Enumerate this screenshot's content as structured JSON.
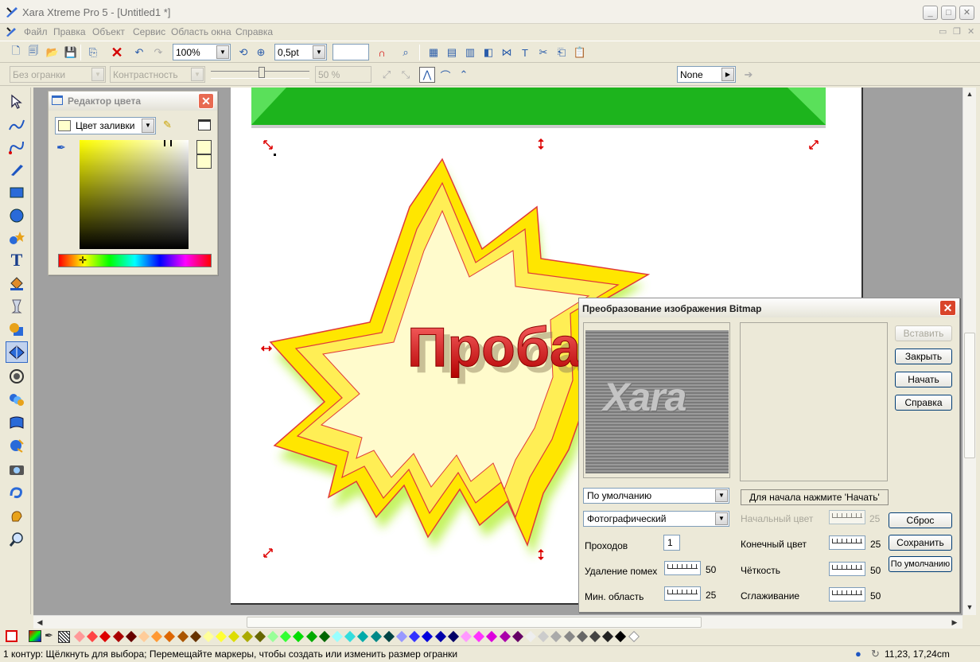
{
  "window": {
    "title": "Xara Xtreme Pro 5 - [Untitled1 *]"
  },
  "menu": [
    "Файл",
    "Правка",
    "Объект",
    "Сервис",
    "Область окна",
    "Справка"
  ],
  "toolbar": {
    "zoom": "100%",
    "line_width": "0,5pt"
  },
  "toolbar2": {
    "bevel_type": "Без огранки",
    "contrast": "Контрастность",
    "percent": "50 %",
    "none_label": "None"
  },
  "color_editor": {
    "title": "Редактор цвета",
    "fill_combo": "Цвет заливки"
  },
  "canvas": {
    "text": "Проба"
  },
  "bitmap_dialog": {
    "title": "Преобразование изображения Bitmap",
    "preview_text": "Xara",
    "buttons": {
      "insert": "Вставить",
      "close": "Закрыть",
      "start": "Начать",
      "help": "Справка",
      "reset": "Сброс",
      "save": "Сохранить",
      "default": "По умолчанию"
    },
    "preset": "По умолчанию",
    "mode": "Фотографический",
    "status": "Для начала нажмите 'Начать'",
    "passes_label": "Проходов",
    "passes_value": "1",
    "noise_label": "Удаление помех",
    "noise_value": "50",
    "min_area_label": "Мин. область",
    "min_area_value": "25",
    "start_color_label": "Начальный цвет",
    "start_color_value": "25",
    "end_color_label": "Конечный цвет",
    "end_color_value": "25",
    "sharpness_label": "Чёткость",
    "sharpness_value": "50",
    "smoothing_label": "Сглаживание",
    "smoothing_value": "50"
  },
  "status": {
    "text": "1 контур: Щёлкнуть для выбора; Перемещайте маркеры, чтобы создать или изменить размер огранки",
    "coords": "11,23, 17,24cm"
  },
  "palette_colors": [
    "#ff9999",
    "#ff4444",
    "#dd0000",
    "#aa0000",
    "#660000",
    "#ffcc99",
    "#ff9933",
    "#dd6600",
    "#aa5500",
    "#663300",
    "#ffff99",
    "#ffff33",
    "#dddd00",
    "#aaaa00",
    "#666600",
    "#99ff99",
    "#33ff33",
    "#00dd00",
    "#00aa00",
    "#006600",
    "#99ffff",
    "#33dddd",
    "#00aaaa",
    "#008888",
    "#004444",
    "#9999ff",
    "#3333ff",
    "#0000dd",
    "#0000aa",
    "#000066",
    "#ff99ff",
    "#ff33ff",
    "#dd00dd",
    "#aa00aa",
    "#660066",
    "#eeeeee",
    "#cccccc",
    "#aaaaaa",
    "#888888",
    "#666666",
    "#444444",
    "#222222",
    "#000000",
    "#ffffff"
  ]
}
